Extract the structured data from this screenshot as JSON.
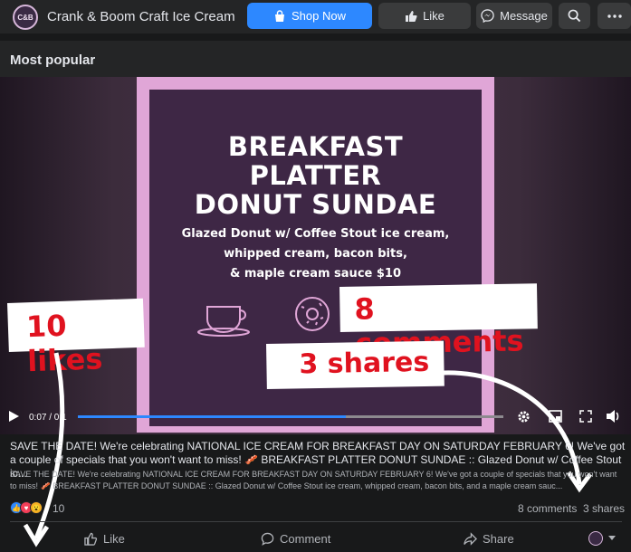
{
  "header": {
    "logo_text": "C&B",
    "page_name": "Crank & Boom Craft Ice Cream",
    "shop_label": "Shop Now",
    "like_label": "Like",
    "message_label": "Message",
    "icons": [
      "shop-bag-icon",
      "thumbs-up-icon",
      "messenger-icon",
      "search-icon",
      "more-icon"
    ]
  },
  "section": {
    "title": "Most popular"
  },
  "poster": {
    "title_lines": [
      "BREAKFAST",
      "PLATTER",
      "DONUT SUNDAE"
    ],
    "desc_lines": [
      "Glazed Donut w/ Coffee Stout ice cream,",
      "whipped cream, bacon bits,",
      "& maple cream sauce   $10"
    ],
    "frame_color": "#e0a6d7",
    "bg_color": "#3e2745"
  },
  "annotations": {
    "likes": "10 likes",
    "comments": "8 comments",
    "shares": "3 shares",
    "color": "#e0121f"
  },
  "video": {
    "time_label": "0:07 / 0:1",
    "progress": 0.63
  },
  "post": {
    "caption_title": "SAVE THE DATE! We're celebrating NATIONAL ICE CREAM FOR BREAKFAST DAY ON SATURDAY FEBRUARY 6! We've got a couple of specials that you won't want to miss! 🥓 BREAKFAST PLATTER DONUT SUNDAE :: Glazed Donut w/ Coffee Stout ic...",
    "caption_body": "SAVE THE DATE! We're celebrating NATIONAL ICE CREAM FOR BREAKFAST DAY ON SATURDAY FEBRUARY 6! We've got a couple of specials that you won't want to miss! 🥓 BREAKFAST PLATTER DONUT SUNDAE :: Glazed Donut w/ Coffee Stout ice cream, whipped cream, bacon bits, and a maple cream sauc...",
    "reaction_count": "10",
    "comments_text": "8 comments",
    "shares_text": "3 shares"
  },
  "actions": {
    "like_label": "Like",
    "comment_label": "Comment",
    "share_label": "Share"
  }
}
